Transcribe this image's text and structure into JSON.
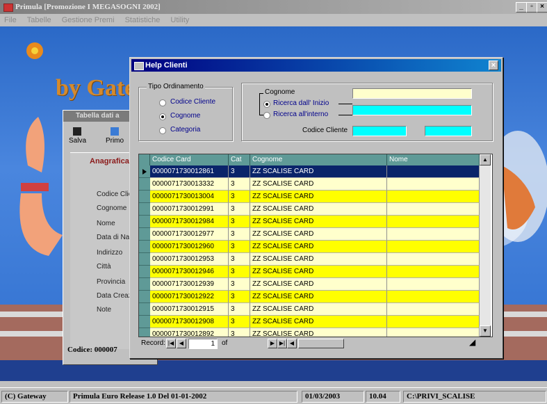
{
  "window": {
    "title": "Primula  [Promozione I MEGASOGNI 2002]",
    "menu": [
      "File",
      "Tabelle",
      "Gestione Premi",
      "Statistiche",
      "Utility"
    ],
    "buttons": {
      "minimize": "_",
      "restore": "▫",
      "close": "×"
    }
  },
  "background": {
    "brand_text": "by Gateway S.r.l.",
    "form": {
      "title": "Tabella dati a",
      "toolbar": [
        "Salva",
        "Primo"
      ],
      "section": "Anagrafica",
      "fields": [
        "Codice Clie",
        "Cognome",
        "Nome",
        "Data di Nas",
        "Indirizzo",
        "Città",
        "Provincia",
        "Data Creazi",
        "Note"
      ],
      "footer": "Codice: 000007"
    }
  },
  "dialog": {
    "title": "Help Clienti",
    "close": "×",
    "tipo_ordinamento": {
      "legend": "Tipo Ordinamento",
      "options": [
        {
          "label": "Codice Cliente",
          "selected": false
        },
        {
          "label": "Cognome",
          "selected": true
        },
        {
          "label": "Categoria",
          "selected": false
        }
      ]
    },
    "search": {
      "legend": "Cognome",
      "options": [
        {
          "label": "Ricerca dall' Inizio",
          "selected": true
        },
        {
          "label": "Ricerca all'interno",
          "selected": false
        }
      ],
      "codice_cliente_label": "Codice Cliente",
      "cognome_value": "",
      "codice_value": ""
    },
    "grid": {
      "columns": [
        "Codice Card",
        "Cat",
        "Cognome",
        "Nome"
      ],
      "rows": [
        {
          "codice": "0000071730012861",
          "cat": "3",
          "cognome": "ZZ SCALISE CARD",
          "nome": "",
          "style": "sel"
        },
        {
          "codice": "0000071730013332",
          "cat": "3",
          "cognome": "ZZ SCALISE CARD",
          "nome": "",
          "style": "w"
        },
        {
          "codice": "0000071730013004",
          "cat": "3",
          "cognome": "ZZ SCALISE CARD",
          "nome": "",
          "style": "y"
        },
        {
          "codice": "0000071730012991",
          "cat": "3",
          "cognome": "ZZ SCALISE CARD",
          "nome": "",
          "style": "w"
        },
        {
          "codice": "0000071730012984",
          "cat": "3",
          "cognome": "ZZ SCALISE CARD",
          "nome": "",
          "style": "y"
        },
        {
          "codice": "0000071730012977",
          "cat": "3",
          "cognome": "ZZ SCALISE CARD",
          "nome": "",
          "style": "w"
        },
        {
          "codice": "0000071730012960",
          "cat": "3",
          "cognome": "ZZ SCALISE CARD",
          "nome": "",
          "style": "y"
        },
        {
          "codice": "0000071730012953",
          "cat": "3",
          "cognome": "ZZ SCALISE CARD",
          "nome": "",
          "style": "w"
        },
        {
          "codice": "0000071730012946",
          "cat": "3",
          "cognome": "ZZ SCALISE CARD",
          "nome": "",
          "style": "y"
        },
        {
          "codice": "0000071730012939",
          "cat": "3",
          "cognome": "ZZ SCALISE CARD",
          "nome": "",
          "style": "w"
        },
        {
          "codice": "0000071730012922",
          "cat": "3",
          "cognome": "ZZ SCALISE CARD",
          "nome": "",
          "style": "y"
        },
        {
          "codice": "0000071730012915",
          "cat": "3",
          "cognome": "ZZ SCALISE CARD",
          "nome": "",
          "style": "w"
        },
        {
          "codice": "0000071730012908",
          "cat": "3",
          "cognome": "ZZ SCALISE CARD",
          "nome": "",
          "style": "y"
        },
        {
          "codice": "0000071730012892",
          "cat": "3",
          "cognome": "ZZ SCALISE CARD",
          "nome": "",
          "style": "w"
        }
      ]
    },
    "navigator": {
      "record_label": "Record:",
      "current": "1",
      "of_label": "of"
    }
  },
  "status_bar": {
    "company": "(C) Gateway",
    "release": "Primula  Euro Release 1.0   Del  01-01-2002",
    "date": "01/03/2003",
    "time": "10.04",
    "path": "C:\\PRIVI_SCALISE"
  },
  "colors": {
    "row_yellow": "#ffff00",
    "row_light": "#ffffcc",
    "selected": "#0a246a",
    "header": "#5f9a97",
    "input_cyan": "#00ffff",
    "input_light": "#ffffcc"
  }
}
